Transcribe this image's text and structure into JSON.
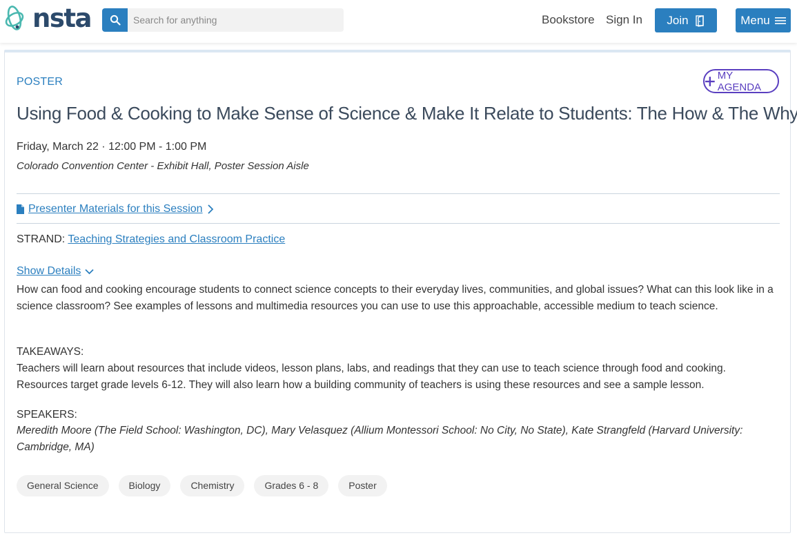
{
  "header": {
    "logo_text": "nsta",
    "search_placeholder": "Search for anything",
    "nav": {
      "bookstore": "Bookstore",
      "sign_in": "Sign In",
      "join": "Join",
      "menu": "Menu"
    }
  },
  "session": {
    "type": "POSTER",
    "agenda_button": "MY AGENDA",
    "title": "Using Food & Cooking to Make Sense of Science & Make It Relate to Students: The How & The Why",
    "datetime": "Friday, March 22 · 12:00 PM - 1:00 PM",
    "location": "Colorado Convention Center - Exhibit Hall, Poster Session Aisle",
    "materials_link": "Presenter Materials for this Session",
    "strand_label": "STRAND:",
    "strand_value": "Teaching Strategies and Classroom Practice",
    "show_details": "Show Details",
    "description": "How can food and cooking encourage students to connect science concepts to their everyday lives, communities, and global issues? What can this look like in a science classroom? See examples of lessons and multimedia resources you can use to use this approachable, accessible medium to teach science.",
    "takeaways_label": "TAKEAWAYS:",
    "takeaways": "Teachers will learn about resources that include videos, lesson plans, labs, and readings that they can use to teach science through food and cooking. Resources target grade levels 6-12. They will also learn how a building community of teachers is using these resources and see a sample lesson.",
    "speakers_label": "SPEAKERS:",
    "speakers": "Meredith Moore (The Field School: Washington, DC), Mary Velasquez (Allium Montessori School: No City, No State), Kate Strangfeld (Harvard University: Cambridge, MA)",
    "tags": [
      "General Science",
      "Biology",
      "Chemistry",
      "Grades 6 - 8",
      "Poster"
    ]
  },
  "colors": {
    "accent": "#2b7fbf",
    "agenda": "#5a3fc0",
    "title": "#3b4a5c"
  }
}
